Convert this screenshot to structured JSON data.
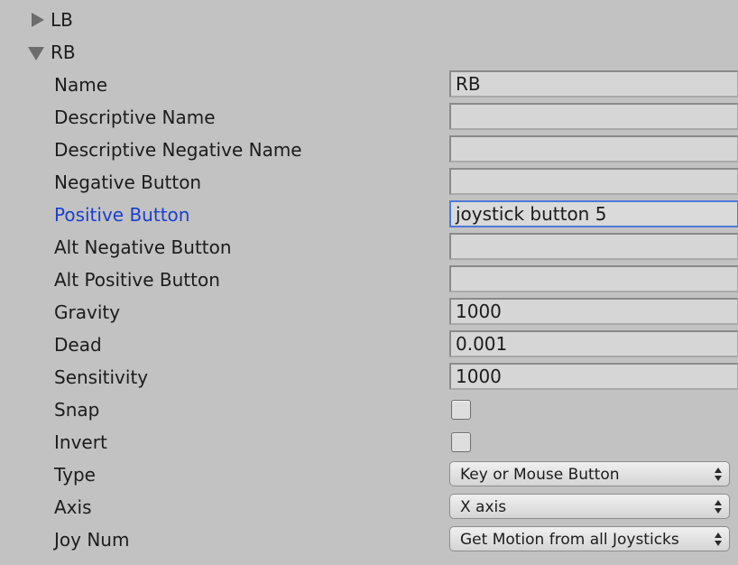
{
  "foldouts": {
    "lb": {
      "label": "LB",
      "expanded": false
    },
    "rb": {
      "label": "RB",
      "expanded": true
    }
  },
  "fields": {
    "name": {
      "label": "Name",
      "value": "RB"
    },
    "descriptive_name": {
      "label": "Descriptive Name",
      "value": ""
    },
    "descriptive_negative_name": {
      "label": "Descriptive Negative Name",
      "value": ""
    },
    "negative_button": {
      "label": "Negative Button",
      "value": ""
    },
    "positive_button": {
      "label": "Positive Button",
      "value": "joystick button 5"
    },
    "alt_negative_button": {
      "label": "Alt Negative Button",
      "value": ""
    },
    "alt_positive_button": {
      "label": "Alt Positive Button",
      "value": ""
    },
    "gravity": {
      "label": "Gravity",
      "value": "1000"
    },
    "dead": {
      "label": "Dead",
      "value": "0.001"
    },
    "sensitivity": {
      "label": "Sensitivity",
      "value": "1000"
    },
    "snap": {
      "label": "Snap",
      "checked": false
    },
    "invert": {
      "label": "Invert",
      "checked": false
    },
    "type": {
      "label": "Type",
      "selected": "Key or Mouse Button"
    },
    "axis": {
      "label": "Axis",
      "selected": "X axis"
    },
    "joy_num": {
      "label": "Joy Num",
      "selected": "Get Motion from all Joysticks"
    }
  },
  "colors": {
    "background": "#c2c2c2",
    "focused_label": "#1a3fd0",
    "focused_border": "#4f78d8"
  },
  "icons": {
    "collapsed": "triangle-right-icon",
    "expanded": "triangle-down-icon",
    "dropdown": "updown-arrows-icon"
  }
}
